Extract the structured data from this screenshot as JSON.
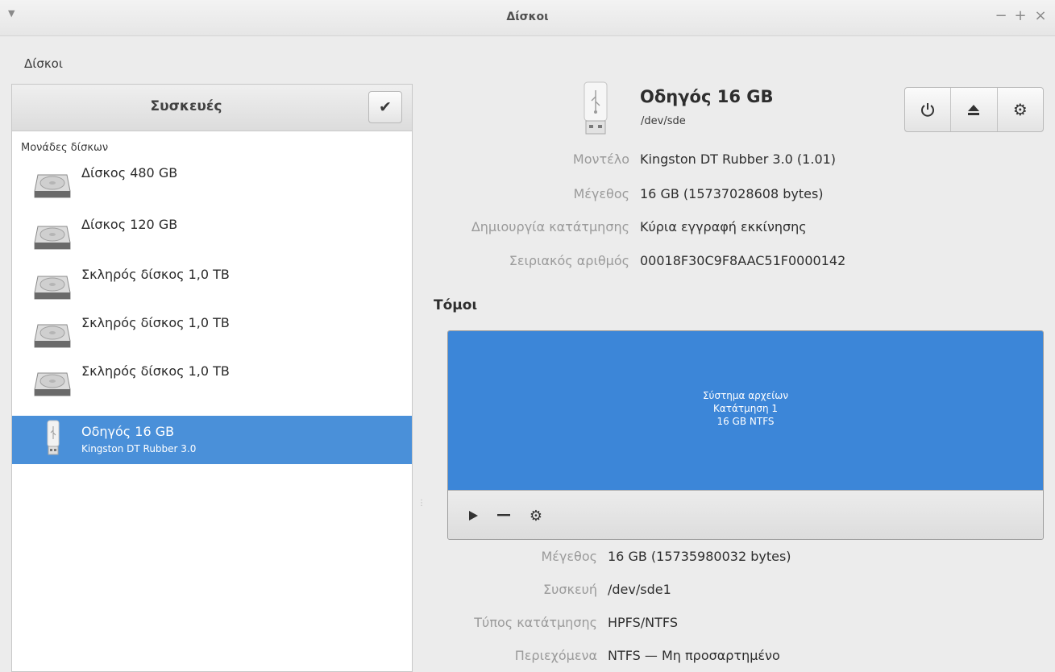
{
  "window": {
    "title": "Δίσκοι",
    "controls": {
      "minimize": "−",
      "maximize": "+",
      "close": "×"
    }
  },
  "menubar": {
    "app_menu": "Δίσκοι"
  },
  "sidebar": {
    "header": "Συσκευές",
    "group_label": "Μονάδες δίσκων",
    "devices": [
      {
        "name": "Δίσκος 480 GB",
        "sub": "",
        "icon": "hard-disk-icon",
        "selected": false
      },
      {
        "name": "Δίσκος 120 GB",
        "sub": "",
        "icon": "hard-disk-icon",
        "selected": false
      },
      {
        "name": "Σκληρός δίσκος 1,0 TB",
        "sub": "",
        "icon": "hard-disk-icon",
        "selected": false
      },
      {
        "name": "Σκληρός δίσκος 1,0 TB",
        "sub": "",
        "icon": "hard-disk-icon",
        "selected": false
      },
      {
        "name": "Σκληρός δίσκος 1,0 TB",
        "sub": "",
        "icon": "hard-disk-icon",
        "selected": false
      },
      {
        "name": "Οδηγός 16 GB",
        "sub": "Kingston DT Rubber 3.0",
        "icon": "usb-drive-icon",
        "selected": true
      }
    ]
  },
  "drive": {
    "title": "Οδηγός 16 GB",
    "path": "/dev/sde",
    "properties": [
      {
        "label": "Μοντέλο",
        "value": "Kingston DT Rubber 3.0 (1.01)"
      },
      {
        "label": "Μέγεθος",
        "value": "16 GB (15737028608 bytes)"
      },
      {
        "label": "Δημιουργία κατάτμησης",
        "value": "Κύρια εγγραφή εκκίνησης"
      },
      {
        "label": "Σειριακός αριθμός",
        "value": "00018F30C9F8AAC51F0000142"
      }
    ]
  },
  "volumes": {
    "section_title": "Τόμοι",
    "partition": {
      "line1": "Σύστημα αρχείων",
      "line2": "Κατάτμηση 1",
      "line3": "16 GB NTFS"
    },
    "properties": [
      {
        "label": "Μέγεθος",
        "value": "16 GB (15735980032 bytes)"
      },
      {
        "label": "Συσκευή",
        "value": "/dev/sde1"
      },
      {
        "label": "Τύπος κατάτμησης",
        "value": "HPFS/NTFS"
      },
      {
        "label": "Περιεχόμενα",
        "value": "NTFS — Μη προσαρτημένο"
      }
    ]
  },
  "colors": {
    "selection": "#4a90d9",
    "partition": "#3c86d8"
  }
}
